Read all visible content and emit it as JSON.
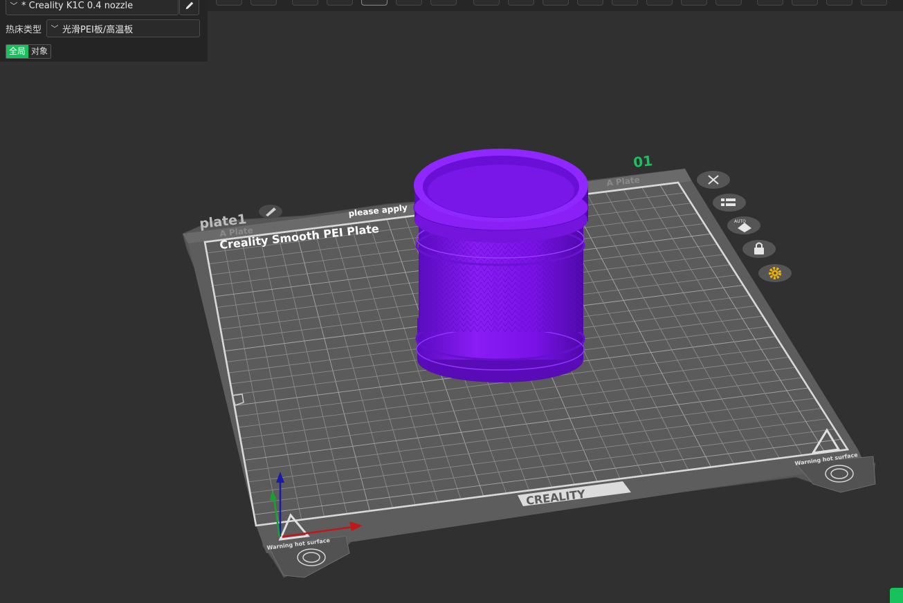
{
  "sidebar": {
    "printer": "* Creality K1C 0.4 nozzle",
    "bed_type_label": "热床类型",
    "bed_type_value": "光滑PEI板/高温板",
    "scope_global": "全局",
    "scope_object": "对象",
    "edit_icon": "pencil-icon",
    "chevron_icon": "chevron-down-icon"
  },
  "plate": {
    "name": "plate1",
    "side_label_left": "A Plate",
    "side_label_right": "A Plate",
    "title": "Creality Smooth PEI Plate",
    "notice": "please apply",
    "number": "01",
    "brand": "CREALITY",
    "warning_left": "Warning hot surface",
    "warning_right": "Warning hot surface"
  },
  "plate_tools": [
    "close-icon",
    "arrange-icon",
    "auto-orient-icon",
    "lock-icon",
    "settings-icon"
  ],
  "plate_tools_auto_label": "AUTO",
  "colors": {
    "accent": "#17c25c",
    "model": "#7a13e8",
    "bed": "#5a5a5a",
    "background": "#303030"
  }
}
